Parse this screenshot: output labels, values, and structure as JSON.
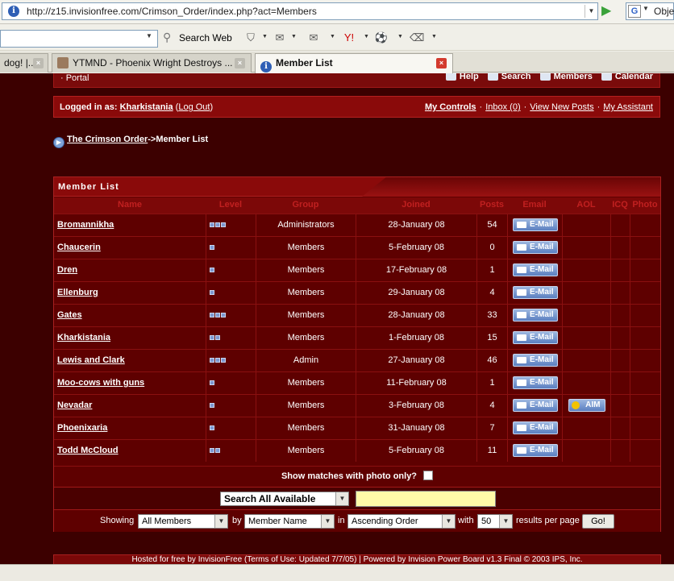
{
  "browser": {
    "url": "http://z15.invisionfree.com/Crimson_Order/index.php?act=Members",
    "search_engine_label": "Obje",
    "toolbar_search_label": "Search Web",
    "tabs": [
      {
        "label": "dog! |..."
      },
      {
        "label": "YTMND - Phoenix Wright Destroys ..."
      },
      {
        "label": "Member List"
      }
    ]
  },
  "forum": {
    "portal_link": "· Portal",
    "nav": [
      "Help",
      "Search",
      "Members",
      "Calendar"
    ],
    "logged_in_prefix": "Logged in as:",
    "username": "Kharkistania",
    "logout_open": "(",
    "logout_label": "Log Out",
    "logout_close": ")",
    "user_links": [
      "My Controls",
      "Inbox (0)",
      "View New Posts",
      "My Assistant"
    ],
    "breadcrumb_link": "The Crimson Order",
    "breadcrumb_current": "->Member List"
  },
  "member_list": {
    "title": "Member List",
    "columns": [
      "Name",
      "Level",
      "Group",
      "Joined",
      "Posts",
      "Email",
      "AOL",
      "ICQ",
      "Photo"
    ],
    "email_label": "E-Mail",
    "aim_label": "AIM",
    "rows": [
      {
        "name": "Bromannikha",
        "level": 3,
        "group": "Administrators",
        "joined": "28-January 08",
        "posts": "54",
        "email": true,
        "aim": false
      },
      {
        "name": "Chaucerin",
        "level": 1,
        "group": "Members",
        "joined": "5-February 08",
        "posts": "0",
        "email": true,
        "aim": false
      },
      {
        "name": "Dren",
        "level": 1,
        "group": "Members",
        "joined": "17-February 08",
        "posts": "1",
        "email": true,
        "aim": false
      },
      {
        "name": "Ellenburg",
        "level": 1,
        "group": "Members",
        "joined": "29-January 08",
        "posts": "4",
        "email": true,
        "aim": false
      },
      {
        "name": "Gates",
        "level": 3,
        "group": "Members",
        "joined": "28-January 08",
        "posts": "33",
        "email": true,
        "aim": false
      },
      {
        "name": "Kharkistania",
        "level": 2,
        "group": "Members",
        "joined": "1-February 08",
        "posts": "15",
        "email": true,
        "aim": false
      },
      {
        "name": "Lewis and Clark",
        "level": 3,
        "group": "Admin",
        "joined": "27-January 08",
        "posts": "46",
        "email": true,
        "aim": false
      },
      {
        "name": "Moo-cows with guns",
        "level": 1,
        "group": "Members",
        "joined": "11-February 08",
        "posts": "1",
        "email": true,
        "aim": false
      },
      {
        "name": "Nevadar",
        "level": 1,
        "group": "Members",
        "joined": "3-February 08",
        "posts": "4",
        "email": true,
        "aim": true
      },
      {
        "name": "Phoenixaria",
        "level": 1,
        "group": "Members",
        "joined": "31-January 08",
        "posts": "7",
        "email": true,
        "aim": false
      },
      {
        "name": "Todd McCloud",
        "level": 2,
        "group": "Members",
        "joined": "5-February 08",
        "posts": "11",
        "email": true,
        "aim": false
      }
    ],
    "photo_only_label": "Show matches with photo only?",
    "search_select": "Search All Available",
    "search_value": "",
    "showing_label": "Showing",
    "filter_select": "All Members",
    "by_label": "by",
    "sort_select": "Member Name",
    "in_label": "in",
    "order_select": "Ascending Order",
    "with_label": "with",
    "per_page_select": "50",
    "per_page_label": "results per page",
    "go_label": "Go!"
  },
  "footer": "Hosted for free by InvisionFree (Terms of Use: Updated 7/7/05) | Powered by Invision Power Board v1.3 Final © 2003 IPS, Inc.",
  "colors": {
    "accent_red": "#8a0a0a",
    "page_bg": "#3c0000",
    "email_button": "#5b7fc0"
  }
}
